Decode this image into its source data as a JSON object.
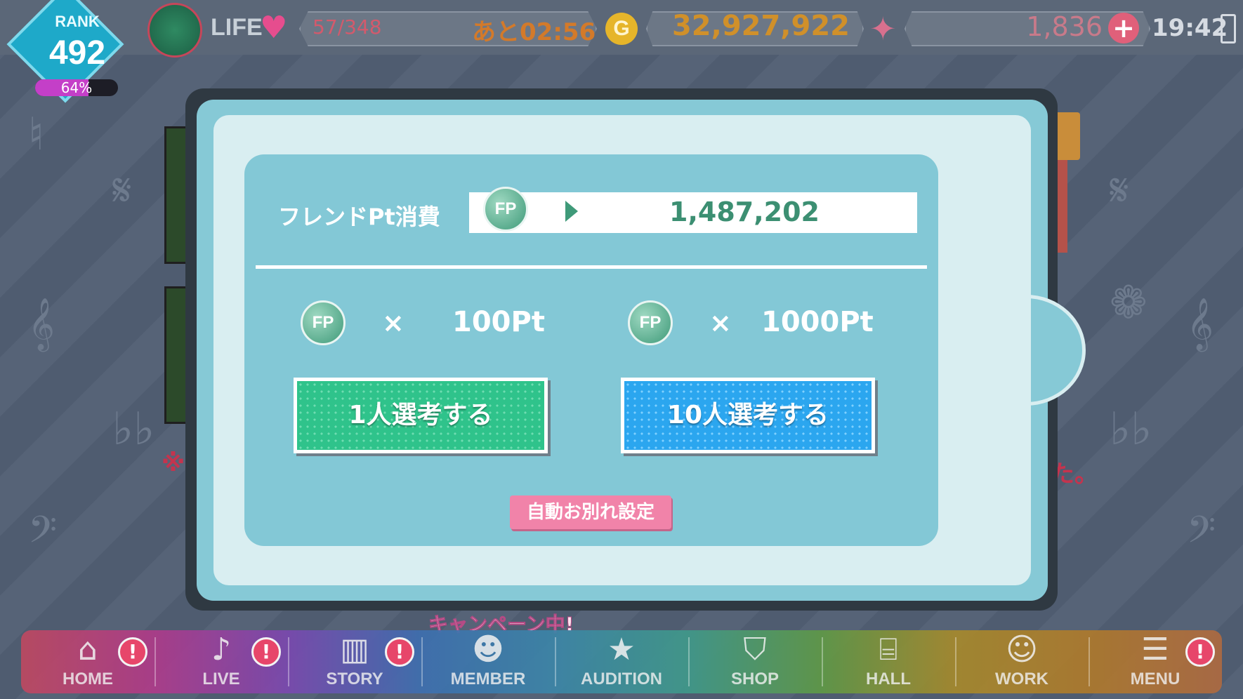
{
  "status_bar": {
    "rank_label": "RANK",
    "rank_value": "492",
    "rank_progress": 0.64,
    "rank_progress_text": "64%",
    "life_label": "LIFE",
    "life_count": "57/348",
    "life_timer": "あと02:56",
    "gold_symbol": "G",
    "gold_value": "32,927,922",
    "gem_value": "1,836",
    "plus_symbol": "+",
    "clock": "19:42"
  },
  "background": {
    "campaign_text": "キャンペーン中!",
    "note_left": "※",
    "note_right": "た。"
  },
  "dialog": {
    "consume_label": "フレンドPt消費",
    "consume_value": "1,487,202",
    "fp_icon_text": "FP",
    "single_times": "×",
    "single_cost": "100Pt",
    "ten_times": "×",
    "ten_cost": "1000Pt",
    "single_button": "1人選考する",
    "ten_button": "10人選考する",
    "auto_farewell_button": "自動お別れ設定",
    "close_symbol": "✕"
  },
  "nav": {
    "items": [
      {
        "label": "HOME",
        "icon": "house-icon"
      },
      {
        "label": "LIVE",
        "icon": "music-note-icon"
      },
      {
        "label": "STORY",
        "icon": "book-icon"
      },
      {
        "label": "MEMBER",
        "icon": "member-icon"
      },
      {
        "label": "AUDITION",
        "icon": "audition-icon"
      },
      {
        "label": "SHOP",
        "icon": "basket-icon"
      },
      {
        "label": "HALL",
        "icon": "hall-icon"
      },
      {
        "label": "WORK",
        "icon": "work-icon"
      },
      {
        "label": "MENU",
        "icon": "menu-icon"
      }
    ],
    "badge_symbol": "!"
  },
  "colors": {
    "accent_teal": "#86c9d6",
    "button_green": "#2fc38b",
    "button_blue": "#2ba6ef",
    "button_pink": "#f183a9"
  }
}
